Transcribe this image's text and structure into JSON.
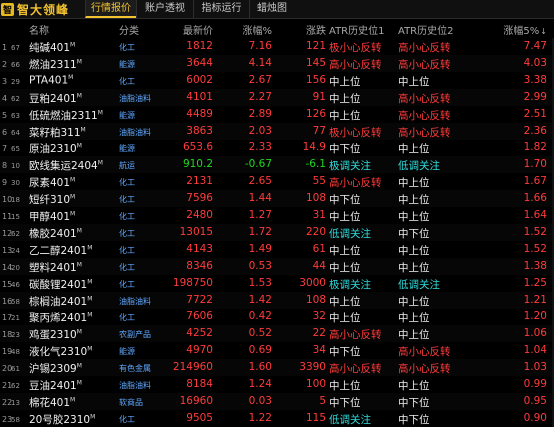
{
  "app": {
    "logo_mark": "智",
    "logo_text": "智大领峰"
  },
  "tabs": [
    {
      "label": "行情报价",
      "active": true
    },
    {
      "label": "账户透视",
      "active": false
    },
    {
      "label": "指标运行",
      "active": false
    },
    {
      "label": "蜡烛图",
      "active": false
    }
  ],
  "columns": {
    "name": "名称",
    "category": "分类",
    "price": "最新价",
    "pct": "涨幅%",
    "chg": "涨跌",
    "atr1": "ATR历史位1",
    "atr2": "ATR历史位2",
    "amp": "涨幅5%",
    "sort_icon": "↓"
  },
  "colors": {
    "red": "#ff3b3b",
    "green": "#1fd81f",
    "cyan": "#2fdcdc",
    "yellow": "#f2c230",
    "category_blue": "#5fa8ff"
  },
  "rows": [
    {
      "idx": "1",
      "code": "67",
      "name": "纯碱401",
      "sup": "M",
      "category": "化工",
      "price": "1812",
      "pct": "7.16",
      "chg": "121",
      "atr1": "极小心反转",
      "atr2": "高小心反转",
      "amp": "7.47",
      "color": "red",
      "atr1c": "red",
      "atr2c": "red"
    },
    {
      "idx": "2",
      "code": "66",
      "name": "燃油2311",
      "sup": "M",
      "category": "能源",
      "price": "3644",
      "pct": "4.14",
      "chg": "145",
      "atr1": "高小心反转",
      "atr2": "高小心反转",
      "amp": "4.03",
      "color": "red",
      "atr1c": "red",
      "atr2c": "red"
    },
    {
      "idx": "3",
      "code": "29",
      "name": "PTA401",
      "sup": "M",
      "category": "化工",
      "price": "6002",
      "pct": "2.67",
      "chg": "156",
      "atr1": "中上位",
      "atr2": "中上位",
      "amp": "3.38",
      "color": "red",
      "atr1c": "white",
      "atr2c": "white"
    },
    {
      "idx": "4",
      "code": "62",
      "name": "豆粕2401",
      "sup": "M",
      "category": "油脂油料",
      "price": "4101",
      "pct": "2.27",
      "chg": "91",
      "atr1": "中上位",
      "atr2": "高小心反转",
      "amp": "2.99",
      "color": "red",
      "atr1c": "white",
      "atr2c": "red"
    },
    {
      "idx": "5",
      "code": "63",
      "name": "低硫燃油2311",
      "sup": "M",
      "category": "能源",
      "price": "4489",
      "pct": "2.89",
      "chg": "126",
      "atr1": "中上位",
      "atr2": "高小心反转",
      "amp": "2.51",
      "color": "red",
      "atr1c": "white",
      "atr2c": "red"
    },
    {
      "idx": "6",
      "code": "64",
      "name": "菜籽粕311",
      "sup": "M",
      "category": "油脂油料",
      "price": "3863",
      "pct": "2.03",
      "chg": "77",
      "atr1": "极小心反转",
      "atr2": "高小心反转",
      "amp": "2.36",
      "color": "red",
      "atr1c": "red",
      "atr2c": "red"
    },
    {
      "idx": "7",
      "code": "65",
      "name": "原油2310",
      "sup": "M",
      "category": "能源",
      "price": "653.6",
      "pct": "2.33",
      "chg": "14.9",
      "atr1": "中下位",
      "atr2": "中上位",
      "amp": "1.82",
      "color": "red",
      "atr1c": "white",
      "atr2c": "white"
    },
    {
      "idx": "8",
      "code": "10",
      "name": "欧线集运2404",
      "sup": "M",
      "category": "航运",
      "price": "910.2",
      "pct": "-0.67",
      "chg": "-6.1",
      "atr1": "极调关注",
      "atr2": "低调关注",
      "amp": "1.70",
      "color": "green",
      "atr1c": "cyan",
      "atr2c": "cyan"
    },
    {
      "idx": "9",
      "code": "30",
      "name": "尿素401",
      "sup": "M",
      "category": "化工",
      "price": "2131",
      "pct": "2.65",
      "chg": "55",
      "atr1": "高小心反转",
      "atr2": "中上位",
      "amp": "1.67",
      "color": "red",
      "atr1c": "red",
      "atr2c": "white"
    },
    {
      "idx": "10",
      "code": "18",
      "name": "短纤310",
      "sup": "M",
      "category": "化工",
      "price": "7596",
      "pct": "1.44",
      "chg": "108",
      "atr1": "中下位",
      "atr2": "中上位",
      "amp": "1.66",
      "color": "red",
      "atr1c": "white",
      "atr2c": "white"
    },
    {
      "idx": "11",
      "code": "15",
      "name": "甲醇401",
      "sup": "M",
      "category": "化工",
      "price": "2480",
      "pct": "1.27",
      "chg": "31",
      "atr1": "中上位",
      "atr2": "中上位",
      "amp": "1.64",
      "color": "red",
      "atr1c": "white",
      "atr2c": "white"
    },
    {
      "idx": "12",
      "code": "62",
      "name": "橡胶2401",
      "sup": "M",
      "category": "化工",
      "price": "13015",
      "pct": "1.72",
      "chg": "220",
      "atr1": "低调关注",
      "atr2": "中下位",
      "amp": "1.52",
      "color": "red",
      "atr1c": "cyan",
      "atr2c": "white"
    },
    {
      "idx": "13",
      "code": "24",
      "name": "乙二醇2401",
      "sup": "M",
      "category": "化工",
      "price": "4143",
      "pct": "1.49",
      "chg": "61",
      "atr1": "中上位",
      "atr2": "中上位",
      "amp": "1.52",
      "color": "red",
      "atr1c": "white",
      "atr2c": "white"
    },
    {
      "idx": "14",
      "code": "20",
      "name": "塑料2401",
      "sup": "M",
      "category": "化工",
      "price": "8346",
      "pct": "0.53",
      "chg": "44",
      "atr1": "中上位",
      "atr2": "中上位",
      "amp": "1.38",
      "color": "red",
      "atr1c": "white",
      "atr2c": "white"
    },
    {
      "idx": "15",
      "code": "46",
      "name": "碳酸锂2401",
      "sup": "M",
      "category": "化工",
      "price": "198750",
      "pct": "1.53",
      "chg": "3000",
      "atr1": "极调关注",
      "atr2": "低调关注",
      "amp": "1.25",
      "color": "red",
      "atr1c": "cyan",
      "atr2c": "cyan"
    },
    {
      "idx": "16",
      "code": "58",
      "name": "棕榈油2401",
      "sup": "M",
      "category": "油脂油料",
      "price": "7722",
      "pct": "1.42",
      "chg": "108",
      "atr1": "中上位",
      "atr2": "中上位",
      "amp": "1.21",
      "color": "red",
      "atr1c": "white",
      "atr2c": "white"
    },
    {
      "idx": "17",
      "code": "21",
      "name": "聚丙烯2401",
      "sup": "M",
      "category": "化工",
      "price": "7606",
      "pct": "0.42",
      "chg": "32",
      "atr1": "中上位",
      "atr2": "中上位",
      "amp": "1.20",
      "color": "red",
      "atr1c": "white",
      "atr2c": "white"
    },
    {
      "idx": "18",
      "code": "23",
      "name": "鸡蛋2310",
      "sup": "M",
      "category": "农副产品",
      "price": "4252",
      "pct": "0.52",
      "chg": "22",
      "atr1": "高小心反转",
      "atr2": "中上位",
      "amp": "1.06",
      "color": "red",
      "atr1c": "red",
      "atr2c": "white"
    },
    {
      "idx": "19",
      "code": "48",
      "name": "液化气2310",
      "sup": "M",
      "category": "能源",
      "price": "4970",
      "pct": "0.69",
      "chg": "34",
      "atr1": "中下位",
      "atr2": "高小心反转",
      "amp": "1.04",
      "color": "red",
      "atr1c": "white",
      "atr2c": "red"
    },
    {
      "idx": "20",
      "code": "61",
      "name": "沪锡2309",
      "sup": "M",
      "category": "有色金属",
      "price": "214960",
      "pct": "1.60",
      "chg": "3390",
      "atr1": "高小心反转",
      "atr2": "高小心反转",
      "amp": "1.03",
      "color": "red",
      "atr1c": "red",
      "atr2c": "red"
    },
    {
      "idx": "21",
      "code": "62",
      "name": "豆油2401",
      "sup": "M",
      "category": "油脂油料",
      "price": "8184",
      "pct": "1.24",
      "chg": "100",
      "atr1": "中上位",
      "atr2": "中上位",
      "amp": "0.99",
      "color": "red",
      "atr1c": "white",
      "atr2c": "white"
    },
    {
      "idx": "22",
      "code": "13",
      "name": "棉花401",
      "sup": "M",
      "category": "软商品",
      "price": "16960",
      "pct": "0.03",
      "chg": "5",
      "atr1": "中下位",
      "atr2": "中下位",
      "amp": "0.95",
      "color": "red",
      "atr1c": "white",
      "atr2c": "white"
    },
    {
      "idx": "23",
      "code": "58",
      "name": "20号胶2310",
      "sup": "M",
      "category": "化工",
      "price": "9505",
      "pct": "1.22",
      "chg": "115",
      "atr1": "低调关注",
      "atr2": "中下位",
      "amp": "0.90",
      "color": "red",
      "atr1c": "cyan",
      "atr2c": "white"
    }
  ]
}
